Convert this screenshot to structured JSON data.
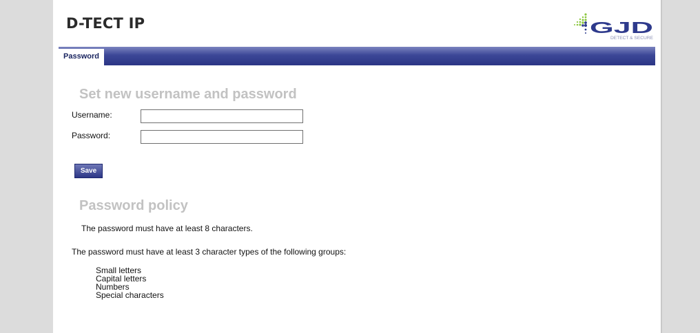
{
  "header": {
    "app_title": "D-TECT IP",
    "logo_text": "GJD",
    "logo_tagline": "DETECT & SECURE"
  },
  "nav": {
    "tabs": [
      {
        "label": "Password",
        "active": true
      }
    ]
  },
  "credentials_form": {
    "title": "Set new username and password",
    "username_label": "Username:",
    "username_value": "",
    "password_label": "Password:",
    "password_value": "",
    "save_label": "Save"
  },
  "policy": {
    "title": "Password policy",
    "rule_length": "The password must have at least 8 characters.",
    "rule_groups": "The password must have at least 3 character types of the following groups:",
    "groups": [
      "Small letters",
      "Capital letters",
      "Numbers",
      "Special characters"
    ]
  },
  "colors": {
    "nav_bar": "#3c4797",
    "section_title": "#c2c2c2",
    "logo_green": "#8cc63f",
    "logo_blue": "#2e3a8c"
  }
}
